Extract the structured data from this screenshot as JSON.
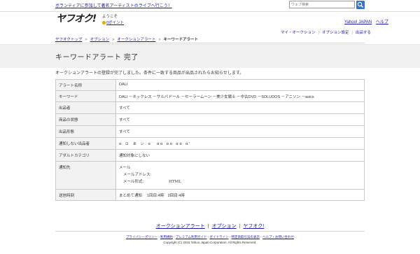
{
  "topbar": {
    "promo": "ボランティアに参加して著名アーティストのライブへ行こう！",
    "search_placeholder": "ウェブ検索"
  },
  "header": {
    "logo": "ヤフオク!",
    "welcome": "ようこそ",
    "points": "0ポイント",
    "yahoo_japan": "Yahoo! JAPAN",
    "help": "ヘルプ"
  },
  "breadcrumb": {
    "items": [
      "ヤフオクトップ",
      "オプション",
      "オークションアラート"
    ],
    "current": "キーワードアラート"
  },
  "toolnav": [
    "マイ・オークション",
    "オプション設定",
    "出品する"
  ],
  "page": {
    "title": "キーワードアラート 完了",
    "message": "オークションアラートの登録が完了しました。条件に一致する商品が出品されたらお知らせします。"
  },
  "table": {
    "rows": [
      {
        "label": "アラート名称",
        "value": "DALI"
      },
      {
        "label": "キーワード",
        "value": "DALI －ネックレス －サルバドール －セーラームーン －美少女戦士 －中古DVD －SOLUDOS －アニソン －asics"
      },
      {
        "label": "出品者",
        "value": "すべて"
      },
      {
        "label": "商品の状態",
        "value": "すべて"
      },
      {
        "label": "出品形態",
        "value": "すべて"
      },
      {
        "label": "通知しない出品者",
        "value": "ɑ ㇿ  ぁ ぃ ɑˈ ɑɑ ɑɑ ɑɑ ɑ'"
      },
      {
        "label": "アダルトカテゴリ",
        "value": "通知対象にしない"
      },
      {
        "label": "通知先",
        "value": "メール",
        "email_address_label": "メールアドレス:",
        "email_format_label": "メール形式:",
        "email_format_value": "HTML"
      },
      {
        "label": "送信時刻",
        "value": "まとめて通知　 1回目:4時　2回目:4時"
      }
    ]
  },
  "footer": {
    "nav": [
      "オークションアラート",
      "オプション",
      "ヤフオク!"
    ],
    "policy_links": [
      "プライバシーポリシー",
      "利用規約",
      "プレミアム利用ガイド",
      "ガイドライン",
      "特定商取引法の表示",
      "ヘルプ・お問い合わせ"
    ],
    "copyright": "Copyright (C) 2015 Yahoo Japan Corporation. All Rights Reserved."
  }
}
